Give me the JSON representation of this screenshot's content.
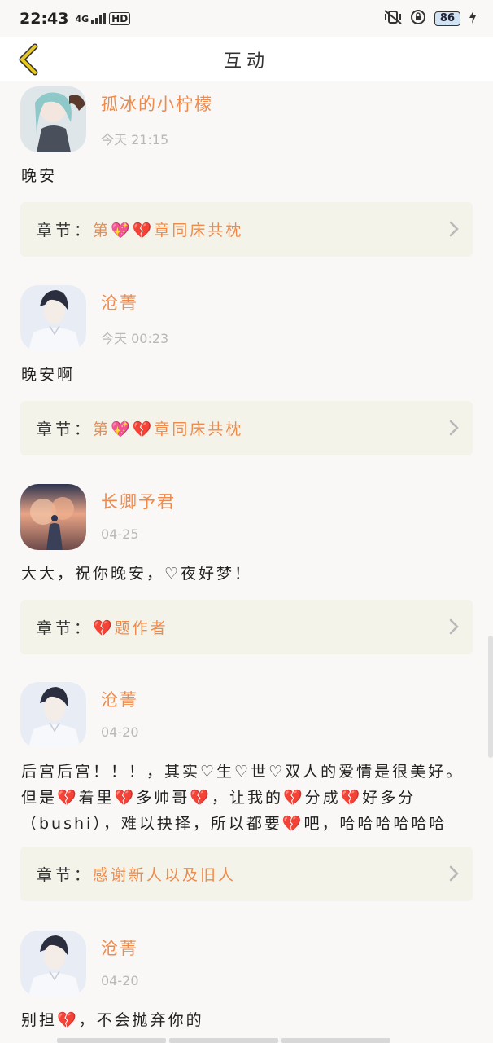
{
  "status": {
    "time": "22:43",
    "network": "4G",
    "hd": "HD",
    "battery": "86"
  },
  "header": {
    "title": "互动"
  },
  "items": [
    {
      "username": "孤冰的小柠檬",
      "time": "今天 21:15",
      "comment": "晚安",
      "chapter_prefix": "章节：",
      "chapter_title": "第💖💔章同床共枕"
    },
    {
      "username": "沧菁",
      "time": "今天 00:23",
      "comment": "晚安啊",
      "chapter_prefix": "章节：",
      "chapter_title": "第💖💔章同床共枕"
    },
    {
      "username": "长卿予君",
      "time": "04-25",
      "comment": "大大，祝你晚安，♡夜好梦！",
      "chapter_prefix": "章节：",
      "chapter_title": "💔题作者"
    },
    {
      "username": "沧菁",
      "time": "04-20",
      "comment": "后宫后宫！！！，其实♡生♡世♡双人的爱情是很美好。但是💔着里💔多帅哥💔，让我的💔分成💔好多分（bushi），难以抉择，所以都要💔吧，哈哈哈哈哈哈",
      "chapter_prefix": "章节：",
      "chapter_title": "感谢新人以及旧人"
    },
    {
      "username": "沧菁",
      "time": "04-20",
      "comment": "别担💔，不会抛弃你的"
    }
  ],
  "colors": {
    "accent": "#f08a4b",
    "card_bg": "#f3f3ea",
    "back_icon": "#e8b820"
  },
  "icons": {
    "back": "back-chevron-icon",
    "chevron": "chevron-right-icon"
  }
}
